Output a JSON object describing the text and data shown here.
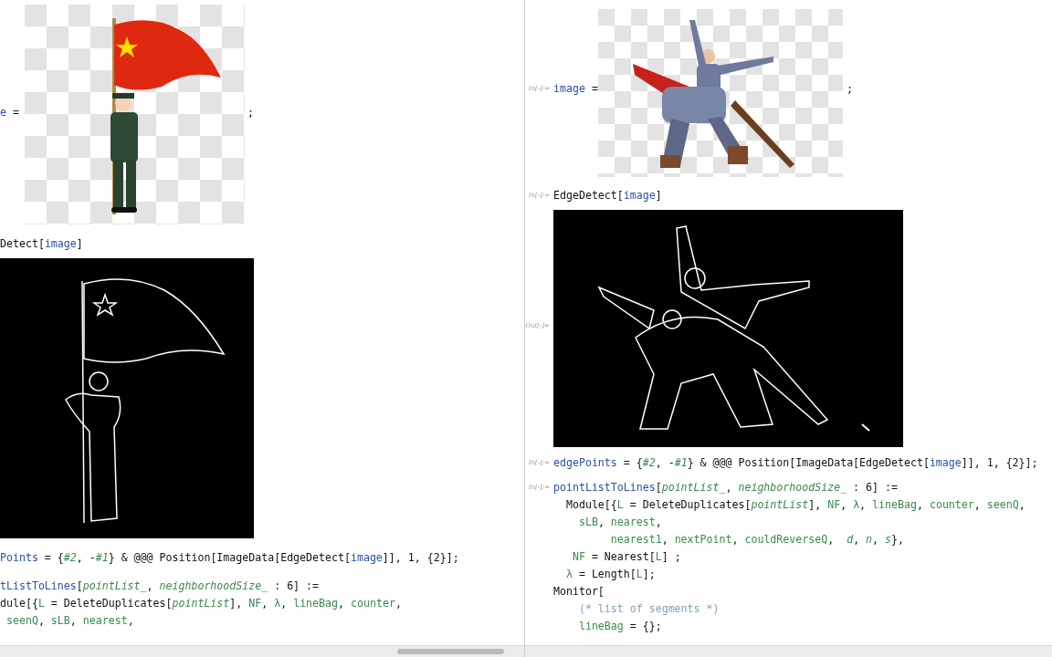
{
  "panes": [
    {
      "cells": [
        {
          "kind": "image_assign",
          "lhs": [
            {
              "t": "e",
              "kind": "var"
            },
            {
              "t": " =",
              "kind": "plain"
            }
          ],
          "end": ";"
        },
        {
          "kind": "code",
          "lines": [
            [
              {
                "t": "Detect[",
                "kind": "plain"
              },
              {
                "t": "image",
                "kind": "var"
              },
              {
                "t": "]",
                "kind": "plain"
              }
            ]
          ]
        },
        {
          "kind": "edge_image"
        },
        {
          "kind": "code",
          "lines": [
            [
              {
                "t": "Points",
                "kind": "var"
              },
              {
                "t": " = {",
                "kind": "plain"
              },
              {
                "t": "#2",
                "kind": "slot"
              },
              {
                "t": ", -",
                "kind": "plain"
              },
              {
                "t": "#1",
                "kind": "slot"
              },
              {
                "t": "} & @@@ Position[ImageData[EdgeDetect[",
                "kind": "plain"
              },
              {
                "t": "image",
                "kind": "var"
              },
              {
                "t": "]], 1, {2}];",
                "kind": "plain"
              }
            ]
          ]
        },
        {
          "kind": "code",
          "lines": [
            [
              {
                "t": "tListToLines",
                "kind": "var"
              },
              {
                "t": "[",
                "kind": "plain"
              },
              {
                "t": "pointList_",
                "kind": "arg"
              },
              {
                "t": ", ",
                "kind": "plain"
              },
              {
                "t": "neighborhoodSize_",
                "kind": "arg"
              },
              {
                "t": " : 6] :=",
                "kind": "plain"
              }
            ],
            [
              {
                "t": "dule[{",
                "kind": "plain"
              },
              {
                "t": "L",
                "kind": "local"
              },
              {
                "t": " = DeleteDuplicates[",
                "kind": "plain"
              },
              {
                "t": "pointList",
                "kind": "arg"
              },
              {
                "t": "], ",
                "kind": "plain"
              },
              {
                "t": "NF",
                "kind": "local"
              },
              {
                "t": ", ",
                "kind": "plain"
              },
              {
                "t": "λ",
                "kind": "local"
              },
              {
                "t": ", ",
                "kind": "plain"
              },
              {
                "t": "lineBag",
                "kind": "local"
              },
              {
                "t": ", ",
                "kind": "plain"
              },
              {
                "t": "counter",
                "kind": "local"
              },
              {
                "t": ",",
                "kind": "plain"
              }
            ],
            [
              {
                "t": " seenQ",
                "kind": "local"
              },
              {
                "t": ", ",
                "kind": "plain"
              },
              {
                "t": "sLB",
                "kind": "local"
              },
              {
                "t": ", ",
                "kind": "plain"
              },
              {
                "t": "nearest",
                "kind": "local"
              },
              {
                "t": ",",
                "kind": "plain"
              }
            ]
          ]
        }
      ]
    },
    {
      "cells": [
        {
          "kind": "image_assign",
          "label": "In[-]:=",
          "lhs": [
            {
              "t": "image",
              "kind": "var"
            },
            {
              "t": " =",
              "kind": "plain"
            }
          ],
          "end": ";"
        },
        {
          "kind": "code",
          "label": "In[-]:=",
          "lines": [
            [
              {
                "t": "EdgeDetect[",
                "kind": "plain"
              },
              {
                "t": "image",
                "kind": "var"
              },
              {
                "t": "]",
                "kind": "plain"
              }
            ]
          ]
        },
        {
          "kind": "edge_image",
          "label": "Out[-]="
        },
        {
          "kind": "code",
          "label": "In[-]:=",
          "lines": [
            [
              {
                "t": "edgePoints",
                "kind": "var"
              },
              {
                "t": " = {",
                "kind": "plain"
              },
              {
                "t": "#2",
                "kind": "slot"
              },
              {
                "t": ", -",
                "kind": "plain"
              },
              {
                "t": "#1",
                "kind": "slot"
              },
              {
                "t": "} & @@@ Position[ImageData[EdgeDetect[",
                "kind": "plain"
              },
              {
                "t": "image",
                "kind": "var"
              },
              {
                "t": "]], 1, {2}];",
                "kind": "plain"
              }
            ]
          ]
        },
        {
          "kind": "code",
          "label": "In[-]:=",
          "lines": [
            [
              {
                "t": "pointListToLines",
                "kind": "var"
              },
              {
                "t": "[",
                "kind": "plain"
              },
              {
                "t": "pointList_",
                "kind": "arg"
              },
              {
                "t": ", ",
                "kind": "plain"
              },
              {
                "t": "neighborhoodSize_",
                "kind": "arg"
              },
              {
                "t": " : 6] :=",
                "kind": "plain"
              }
            ],
            [
              {
                "t": "  Module[{",
                "kind": "plain"
              },
              {
                "t": "L",
                "kind": "local"
              },
              {
                "t": " = DeleteDuplicates[",
                "kind": "plain"
              },
              {
                "t": "pointList",
                "kind": "arg"
              },
              {
                "t": "], ",
                "kind": "plain"
              },
              {
                "t": "NF",
                "kind": "local"
              },
              {
                "t": ", ",
                "kind": "plain"
              },
              {
                "t": "λ",
                "kind": "local"
              },
              {
                "t": ", ",
                "kind": "plain"
              },
              {
                "t": "lineBag",
                "kind": "local"
              },
              {
                "t": ", ",
                "kind": "plain"
              },
              {
                "t": "counter",
                "kind": "local"
              },
              {
                "t": ", ",
                "kind": "plain"
              },
              {
                "t": "seenQ",
                "kind": "local"
              },
              {
                "t": ",",
                "kind": "plain"
              }
            ],
            [
              {
                "t": "    sLB",
                "kind": "local"
              },
              {
                "t": ", ",
                "kind": "plain"
              },
              {
                "t": "nearest",
                "kind": "local"
              },
              {
                "t": ",",
                "kind": "plain"
              }
            ],
            [
              {
                "t": "         nearest1",
                "kind": "local"
              },
              {
                "t": ", ",
                "kind": "plain"
              },
              {
                "t": "nextPoint",
                "kind": "local"
              },
              {
                "t": ", ",
                "kind": "plain"
              },
              {
                "t": "couldReverseQ",
                "kind": "local"
              },
              {
                "t": ",  ",
                "kind": "plain"
              },
              {
                "t": "d",
                "kind": "arg"
              },
              {
                "t": ", ",
                "kind": "plain"
              },
              {
                "t": "n",
                "kind": "arg"
              },
              {
                "t": ", ",
                "kind": "plain"
              },
              {
                "t": "s",
                "kind": "arg"
              },
              {
                "t": "},",
                "kind": "plain"
              }
            ],
            [
              {
                "t": "   NF",
                "kind": "local"
              },
              {
                "t": " = Nearest[",
                "kind": "plain"
              },
              {
                "t": "L",
                "kind": "local"
              },
              {
                "t": "] ;",
                "kind": "plain"
              }
            ],
            [
              {
                "t": "  λ",
                "kind": "local"
              },
              {
                "t": " = Length[",
                "kind": "plain"
              },
              {
                "t": "L",
                "kind": "local"
              },
              {
                "t": "];",
                "kind": "plain"
              }
            ],
            [
              {
                "t": "Monitor[",
                "kind": "plain"
              }
            ],
            [
              {
                "t": "    (* list of segments *)",
                "kind": "comment"
              }
            ],
            [
              {
                "t": "    lineBag",
                "kind": "local"
              },
              {
                "t": " = {};",
                "kind": "plain"
              }
            ]
          ]
        }
      ]
    }
  ]
}
